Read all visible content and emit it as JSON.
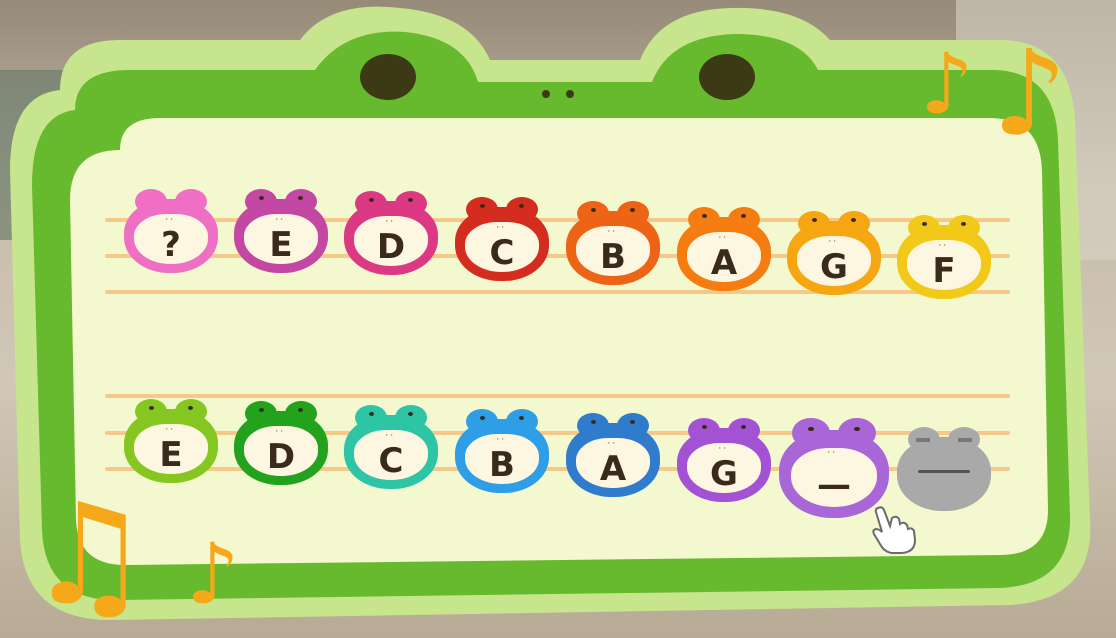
{
  "row1": [
    {
      "label": "?",
      "color": "#ef6fc4",
      "face": "squint"
    },
    {
      "label": "E",
      "color": "#c348a3"
    },
    {
      "label": "D",
      "color": "#dc3985"
    },
    {
      "label": "C",
      "color": "#d42c1f"
    },
    {
      "label": "B",
      "color": "#ee6417"
    },
    {
      "label": "A",
      "color": "#f47c10"
    },
    {
      "label": "G",
      "color": "#f6a611"
    },
    {
      "label": "F",
      "color": "#f3c919"
    }
  ],
  "row2": [
    {
      "label": "E",
      "color": "#86c620"
    },
    {
      "label": "D",
      "color": "#23a21d"
    },
    {
      "label": "C",
      "color": "#2ec4a6"
    },
    {
      "label": "B",
      "color": "#2e9ee6"
    },
    {
      "label": "A",
      "color": "#2f7ccd"
    },
    {
      "label": "G",
      "color": "#a452d4"
    },
    {
      "label": "—",
      "color": "#a866d7",
      "selected": true
    },
    {
      "label": "",
      "color": "#a9a9a9",
      "face": "rest"
    }
  ],
  "colors": {
    "frame_outer": "#c7e58c",
    "frame_body": "#67b92d",
    "panel": "#f4f8cf",
    "staff": "#f4c98a",
    "note_icon": "#f6a81b"
  },
  "icons": [
    "music-note-icon",
    "pointer-hand-icon"
  ]
}
